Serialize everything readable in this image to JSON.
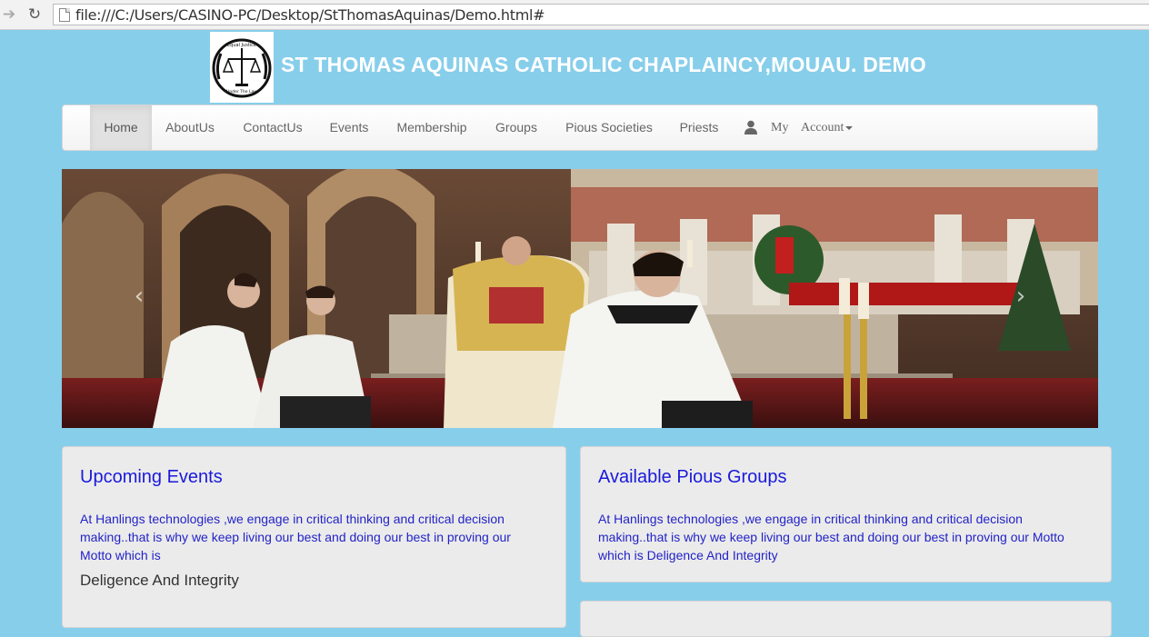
{
  "browser": {
    "url": "file:///C:/Users/CASINO-PC/Desktop/StThomasAquinas/Demo.html#"
  },
  "header": {
    "title": "ST THOMAS AQUINAS CATHOLIC CHAPLAINCY,MOUAU. DEMO",
    "logo_text_top": "Equal Justice",
    "logo_text_bottom": "Under The Law"
  },
  "navbar": {
    "items": [
      {
        "label": "Home"
      },
      {
        "label": "AboutUs"
      },
      {
        "label": "ContactUs"
      },
      {
        "label": "Events"
      },
      {
        "label": "Membership"
      },
      {
        "label": "Groups"
      },
      {
        "label": "Pious Societies"
      },
      {
        "label": "Priests"
      }
    ],
    "account": {
      "label_my": "My",
      "label_account": "Account"
    }
  },
  "carousel": {
    "prev_icon": "chevron-left-icon",
    "next_icon": "chevron-right-icon",
    "prev_glyph": "‹",
    "next_glyph": "›"
  },
  "panels": {
    "events": {
      "title": "Upcoming Events",
      "body": "At Hanlings technologies ,we engage in critical thinking and critical decision making..that is why we keep living our best and doing our best in proving our Motto which is",
      "motto": "Deligence And Integrity"
    },
    "groups": {
      "title": "Available Pious Groups",
      "body": "At Hanlings technologies ,we engage in critical thinking and critical decision making..that is why we keep living our best and doing our best in proving our Motto which is Deligence And Integrity"
    }
  },
  "colors": {
    "page_bg": "#87ceeb",
    "heading_blue": "#1a1adb",
    "body_blue": "#2323c8"
  }
}
